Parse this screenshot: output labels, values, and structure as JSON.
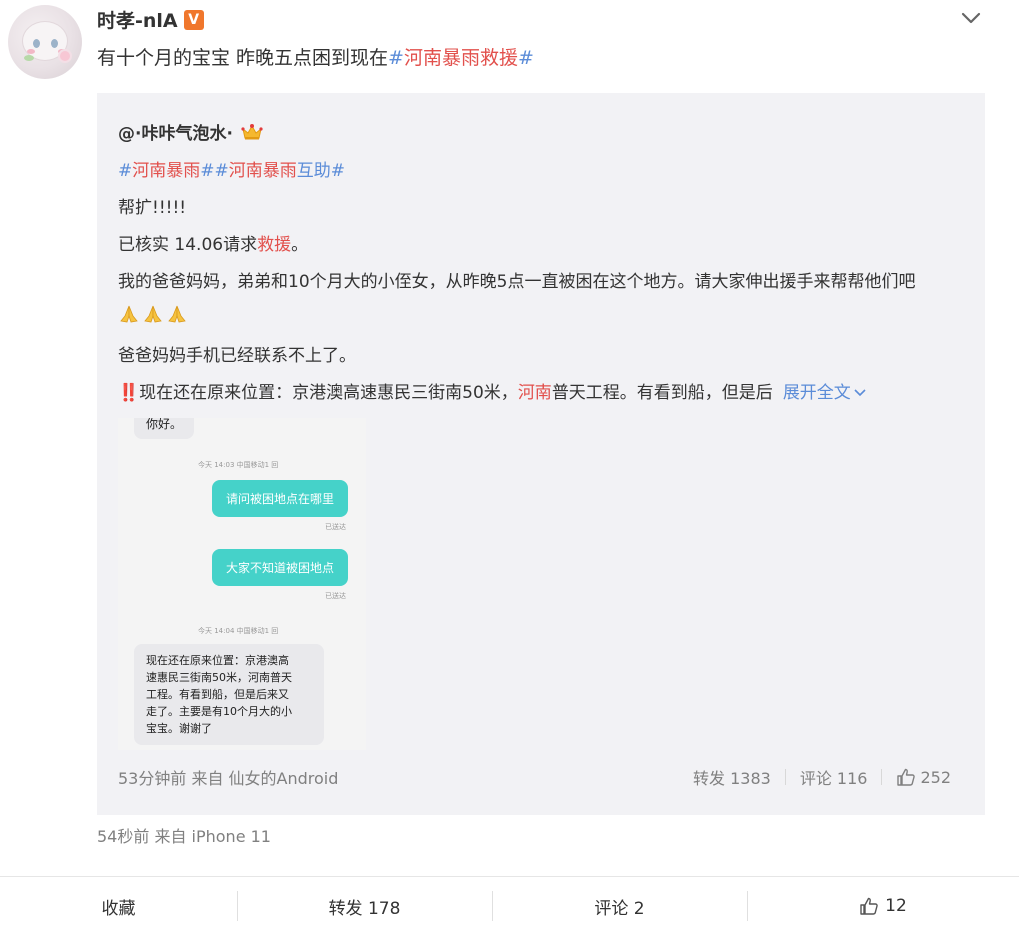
{
  "post": {
    "author": "时孝-nlA",
    "verified_badge": "V",
    "text_plain": "有十个月的宝宝 昨晚五点困到现在",
    "hash_open": "#",
    "topic": "河南暴雨救援",
    "hash_close": "#",
    "meta": "54秒前  来自 iPhone 11"
  },
  "quoted": {
    "author": "@·咔咔气泡水·",
    "tags": {
      "hash1": "#",
      "topic1": "河南暴雨",
      "hash2": "##",
      "topic2": "河南暴雨",
      "topic2_tail": "互助",
      "hash3": "#"
    },
    "line1": "帮扩!!!!!",
    "line2_a": "已核实 14.06请求",
    "line2_topic": "救援",
    "line2_b": "。",
    "line3": "我的爸爸妈妈，弟弟和10个月大的小侄女，从昨晚5点一直被困在这个地方。请大家伸出援手来帮帮他们吧",
    "line5": "爸爸妈妈手机已经联系不上了。",
    "line6_bang": "‼️",
    "line6_a": "现在还在原来位置：京港澳高速惠民三街南50米，",
    "line6_topic": "河南",
    "line6_b": "普天工程。有看到船，但是后",
    "expand": "展开全文",
    "meta": "53分钟前 来自 仙女的Android",
    "reposts": "转发 1383",
    "comments": "评论 116",
    "likes": "252"
  },
  "screenshot": {
    "greeting": "你好。",
    "stamp1": "今天 14:03 中国移动1 回",
    "msg1": "请问被困地点在哪里",
    "sent1": "已送达",
    "msg2": "大家不知道被困地点",
    "sent2": "已送达",
    "stamp2": "今天 14:04 中国移动1 回",
    "reply_lines": [
      "现在还在原来位置：京港澳高",
      "速惠民三街南50米，河南普天",
      "工程。有看到船，但是后来又",
      "走了。主要是有10个月大的小",
      "宝宝。谢谢了"
    ]
  },
  "actions": {
    "favorite": "收藏",
    "repost": "转发 178",
    "comment": "评论 2",
    "like": "12"
  },
  "colors": {
    "topic": "#e2504c",
    "hash": "#5b8cd8",
    "quote_bg": "#f2f2f5",
    "bubble_sent": "#45d2c9"
  }
}
